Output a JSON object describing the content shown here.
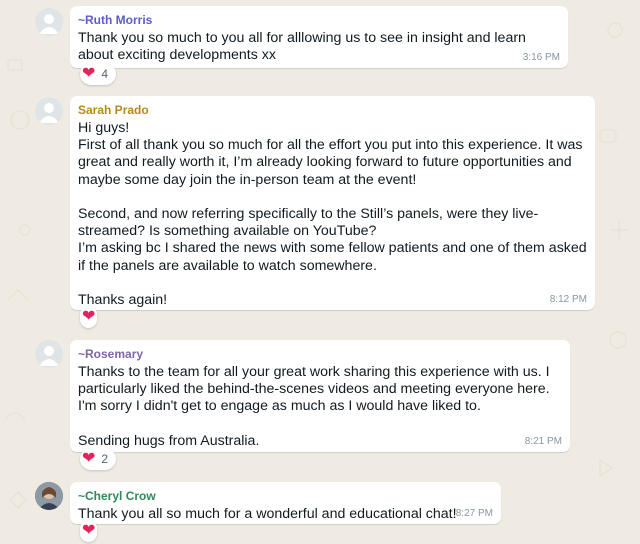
{
  "colors": {
    "background": "#efeae2",
    "bubble": "#ffffff",
    "time": "#8696a0",
    "heart": "#e0245e"
  },
  "messages": [
    {
      "sender": "~Ruth Morris",
      "sender_color": "#5a5ec9",
      "text": "Thank you so much to you all for alllowing us to see in insight and learn about exciting developments xx",
      "time": "3:16 PM",
      "reaction": {
        "icon": "heart-icon",
        "emoji": "❤",
        "count": "4"
      }
    },
    {
      "sender": "Sarah Prado",
      "sender_color": "#b58a18",
      "text": "Hi guys!\nFirst of all thank you so much for all the effort you put into this experience. It was great and really worth it, I’m already looking forward to future opportunities and maybe some day join the in-person team at the event!\n\nSecond, and now referring specifically to the Still’s panels, were they live-streamed? Is something available on YouTube?\nI’m asking bc I shared the news with some fellow patients and one of them asked if the panels are available to watch somewhere.\n\nThanks again!",
      "time": "8:12 PM",
      "reaction": {
        "icon": "heart-icon",
        "emoji": "❤",
        "count": ""
      }
    },
    {
      "sender": "~Rosemary",
      "sender_color": "#7f66a8",
      "text": "Thanks to the team for all your great work sharing this experience with us. I particularly liked the behind-the-scenes videos and meeting everyone here. I'm sorry I didn't get to engage as much as I would have liked to.\n\nSending hugs from Australia.",
      "time": "8:21 PM",
      "reaction": {
        "icon": "heart-icon",
        "emoji": "❤",
        "count": "2"
      }
    },
    {
      "sender": "~Cheryl Crow",
      "sender_color": "#2e8a57",
      "text": "Thank you all so much for a wonderful and educational chat!",
      "time": "8:27 PM",
      "reaction": {
        "icon": "heart-icon",
        "emoji": "❤",
        "count": ""
      }
    }
  ]
}
